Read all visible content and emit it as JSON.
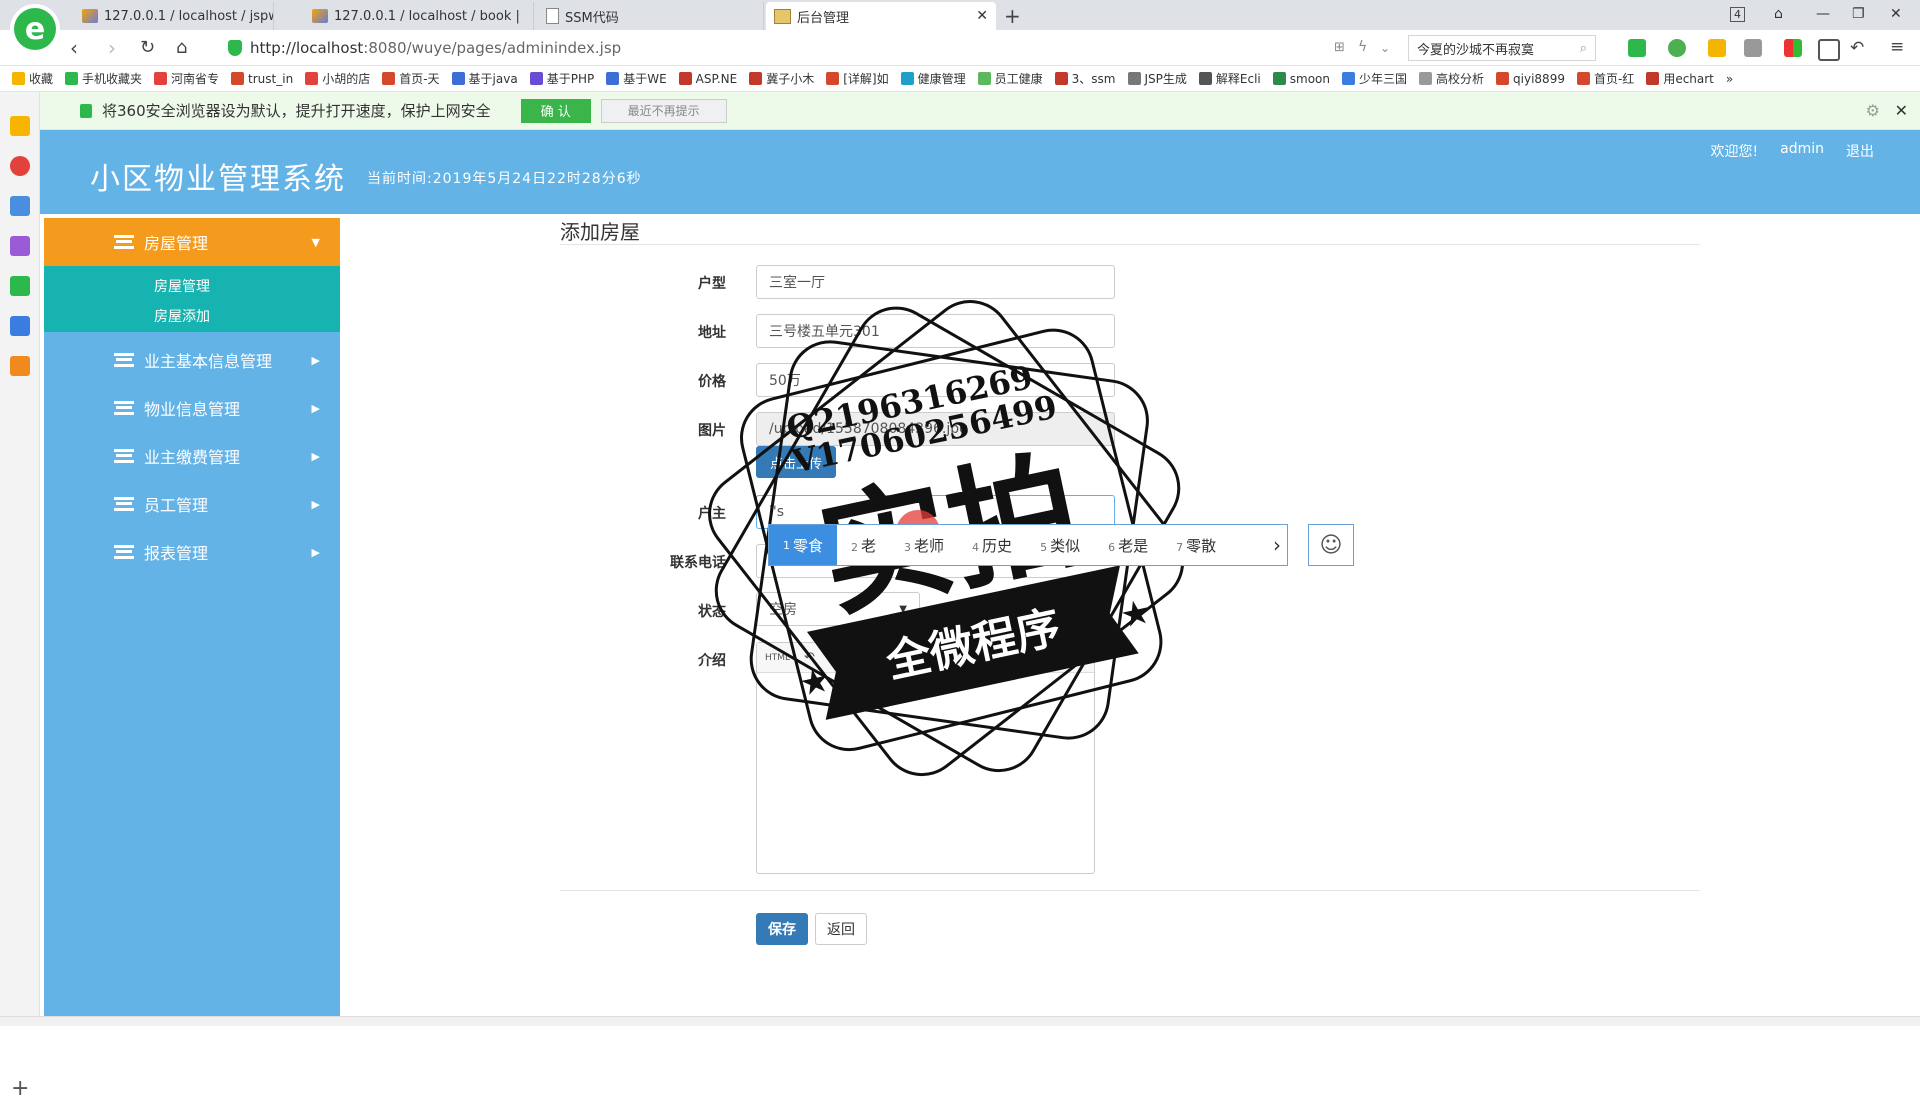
{
  "browser": {
    "tabs": [
      {
        "label": "127.0.0.1 / localhost / jspwuye",
        "icon": "pma"
      },
      {
        "label": "127.0.0.1 / localhost / book | ",
        "icon": "pma"
      },
      {
        "label": "SSM代码",
        "icon": "doc"
      },
      {
        "label": "后台管理",
        "icon": "pic",
        "active": true
      }
    ],
    "tab_count": "4",
    "url_host": "http://localhost",
    "url_rest": ":8080/wuye/pages/adminindex.jsp",
    "search_text": "今夏的沙城不再寂寞",
    "bookmarks": [
      "收藏",
      "手机收藏夹",
      "河南省专",
      "trust_in",
      "小胡的店",
      "首页-天",
      "基于java",
      "基于PHP",
      "基于WE",
      "ASP.NE",
      "冀子小木",
      "[详解]如",
      "健康管理",
      "员工健康",
      "3、ssm",
      "JSP生成",
      "解释Ecli",
      "smoon",
      "少年三国",
      "高校分析",
      "qiyi8899",
      "首页-红",
      "用echart"
    ],
    "notice": "将360安全浏览器设为默认，提升打开速度，保护上网安全",
    "notice_confirm": "确 认",
    "notice_dismiss": "最近不再提示"
  },
  "header": {
    "title": "小区物业管理系统",
    "time": "当前时间:2019年5月24日22时28分6秒",
    "welcome": "欢迎您!",
    "user": "admin",
    "logout": "退出"
  },
  "sidebar": {
    "items": [
      {
        "label": "房屋管理",
        "active": true
      },
      {
        "label": "业主基本信息管理"
      },
      {
        "label": "物业信息管理"
      },
      {
        "label": "业主缴费管理"
      },
      {
        "label": "员工管理"
      },
      {
        "label": "报表管理"
      }
    ],
    "subitems": [
      "房屋管理",
      "房屋添加"
    ]
  },
  "form": {
    "title": "添加房屋",
    "fields": [
      {
        "label": "户型",
        "value": "三室一厅"
      },
      {
        "label": "地址",
        "value": "三号楼五单元301"
      },
      {
        "label": "价格",
        "value": "50万"
      },
      {
        "label": "图片",
        "value": "/upload/1558708084396.jpg"
      },
      {
        "label": "户主",
        "value": "l's"
      },
      {
        "label": "联系电话",
        "value": ""
      },
      {
        "label": "状态",
        "value": "空房"
      },
      {
        "label": "介绍",
        "value": ""
      }
    ],
    "upload_button": "点击上传",
    "save_button": "保存",
    "back_button": "返回"
  },
  "ime": {
    "candidates": [
      {
        "num": "1",
        "text": "零食"
      },
      {
        "num": "2",
        "text": "老"
      },
      {
        "num": "3",
        "text": "老师"
      },
      {
        "num": "4",
        "text": "历史"
      },
      {
        "num": "5",
        "text": "类似"
      },
      {
        "num": "6",
        "text": "老是"
      },
      {
        "num": "7",
        "text": "零散"
      }
    ]
  },
  "watermark": {
    "line1": "Q2196316269",
    "line2": "V17060256499",
    "main": "实拍",
    "banner": "全微程序"
  }
}
